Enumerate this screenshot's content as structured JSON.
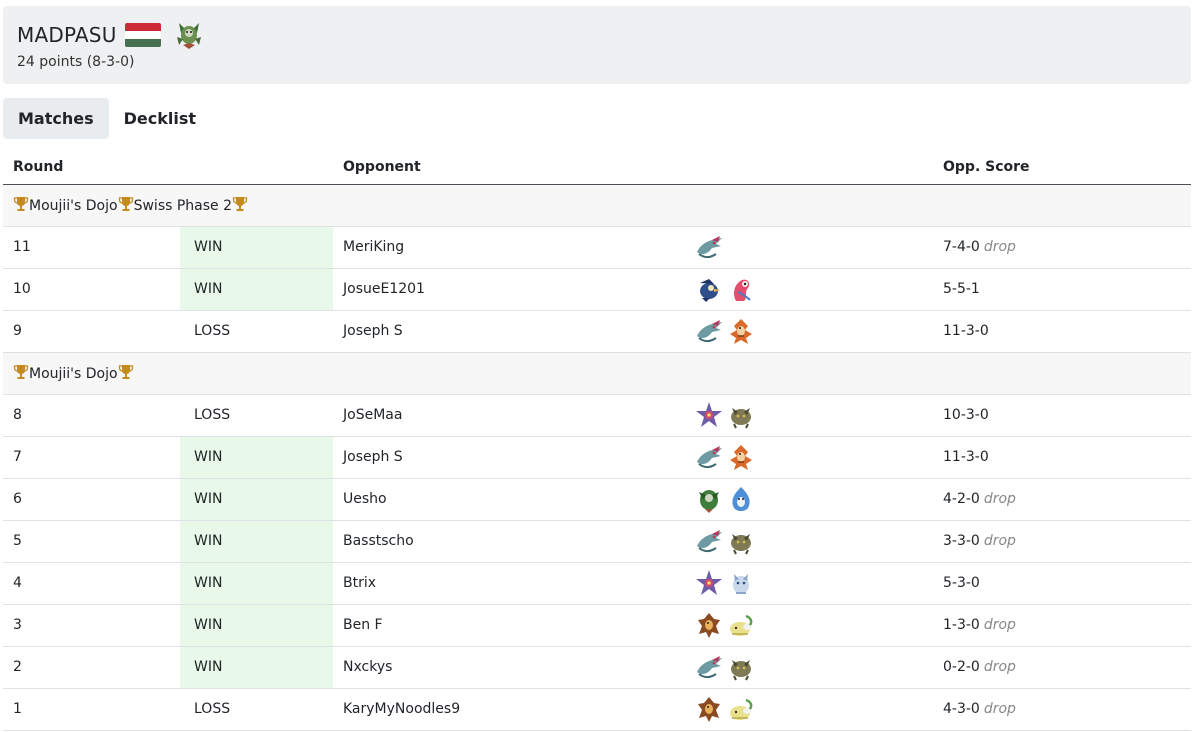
{
  "player": {
    "name": "MADPASU",
    "flag_icon": "hungary-flag-icon",
    "flag_colors": [
      "#ce2939",
      "#ffffff",
      "#477050"
    ],
    "deck_icon": "pokemon-sprite-icon",
    "points": "24 points (8-3-0)"
  },
  "tabs": [
    {
      "label": "Matches",
      "active": true
    },
    {
      "label": "Decklist",
      "active": false
    }
  ],
  "table": {
    "headers": {
      "round": "Round",
      "opponent": "Opponent",
      "score": "Opp. Score"
    },
    "drop_label": "drop",
    "groups": [
      {
        "segments": [
          "Moujii's Dojo",
          "Swiss Phase 2",
          ""
        ],
        "rows": [
          {
            "round": "11",
            "result": "WIN",
            "opponent": "MeriKing",
            "sprites": [
              "dragapult",
              "none"
            ],
            "score": "7-4-0",
            "drop": true
          },
          {
            "round": "10",
            "result": "WIN",
            "opponent": "JosueE1201",
            "sprites": [
              "blue-bird",
              "pink-bird"
            ],
            "score": "5-5-1",
            "drop": false
          },
          {
            "round": "9",
            "result": "LOSS",
            "opponent": "Joseph S",
            "sprites": [
              "dragapult",
              "orange-fighter"
            ],
            "score": "11-3-0",
            "drop": false
          }
        ]
      },
      {
        "segments": [
          "Moujii's Dojo",
          ""
        ],
        "rows": [
          {
            "round": "8",
            "result": "LOSS",
            "opponent": "JoSeMaa",
            "sprites": [
              "starmie",
              "olive-beast"
            ],
            "score": "10-3-0",
            "drop": false
          },
          {
            "round": "7",
            "result": "WIN",
            "opponent": "Joseph S",
            "sprites": [
              "dragapult",
              "orange-fighter"
            ],
            "score": "11-3-0",
            "drop": false
          },
          {
            "round": "6",
            "result": "WIN",
            "opponent": "Uesho",
            "sprites": [
              "green-leaf",
              "blue-water"
            ],
            "score": "4-2-0",
            "drop": true
          },
          {
            "round": "5",
            "result": "WIN",
            "opponent": "Basstscho",
            "sprites": [
              "dragapult",
              "olive-beast"
            ],
            "score": "3-3-0",
            "drop": true
          },
          {
            "round": "4",
            "result": "WIN",
            "opponent": "Btrix",
            "sprites": [
              "starmie",
              "light-blue"
            ],
            "score": "5-3-0",
            "drop": false
          },
          {
            "round": "3",
            "result": "WIN",
            "opponent": "Ben F",
            "sprites": [
              "brown-fighter",
              "yellow-bug"
            ],
            "score": "1-3-0",
            "drop": true
          },
          {
            "round": "2",
            "result": "WIN",
            "opponent": "Nxckys",
            "sprites": [
              "dragapult",
              "olive-beast"
            ],
            "score": "0-2-0",
            "drop": true
          },
          {
            "round": "1",
            "result": "LOSS",
            "opponent": "KaryMyNoodles9",
            "sprites": [
              "brown-fighter",
              "yellow-bug"
            ],
            "score": "4-3-0",
            "drop": true
          }
        ]
      }
    ]
  },
  "colors": {
    "win_bg": "#e8f9ea",
    "header_bg": "#eff0f1",
    "group_bg": "#f7f7f7",
    "trophy": "#c58a1c"
  }
}
